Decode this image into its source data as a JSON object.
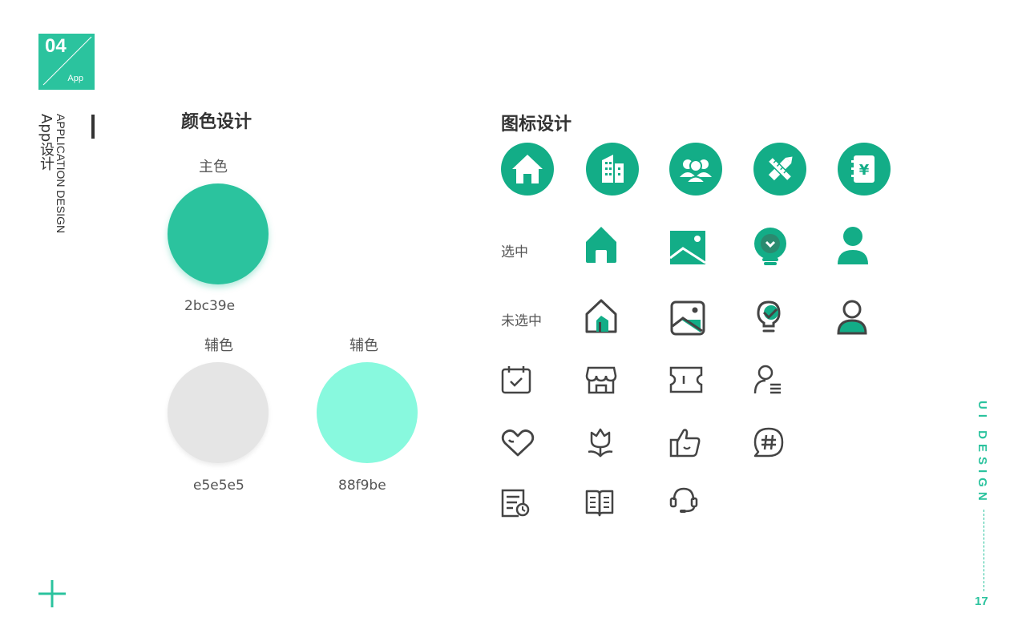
{
  "badge": {
    "number": "04",
    "sub": "App"
  },
  "side": {
    "title_en": "APPLICATION DESIGN",
    "title_cn": "App设计"
  },
  "colors": {
    "title": "颜色设计",
    "items": [
      {
        "label": "主色",
        "hex": "2bc39e",
        "color": "#2bc39e"
      },
      {
        "label": "辅色",
        "hex": "e5e5e5",
        "color": "#e5e5e5"
      },
      {
        "label": "辅色",
        "hex": "88f9be",
        "color": "#88f9de"
      }
    ]
  },
  "icons": {
    "title": "图标设计",
    "selected_label": "选中",
    "unselected_label": "未选中",
    "accent": "#13ad87",
    "stroke": "#444444",
    "top_row": [
      "home-icon",
      "buildings-icon",
      "users-icon",
      "pencil-ruler-icon",
      "yuan-notebook-icon"
    ],
    "selected_row": [
      "home-icon",
      "image-icon",
      "lightbulb-icon",
      "user-icon"
    ],
    "unselected_row": [
      "home-icon",
      "image-icon",
      "lightbulb-icon",
      "user-icon"
    ],
    "line_rows": [
      [
        "calendar-check-icon",
        "store-icon",
        "ticket-icon",
        "user-list-icon"
      ],
      [
        "heart-icon",
        "tulip-icon",
        "thumbs-up-icon",
        "hashtag-chat-icon"
      ],
      [
        "document-clock-icon",
        "book-icon",
        "headset-icon"
      ]
    ]
  },
  "footer": {
    "brand": "UI DESIGN",
    "page": "17"
  }
}
